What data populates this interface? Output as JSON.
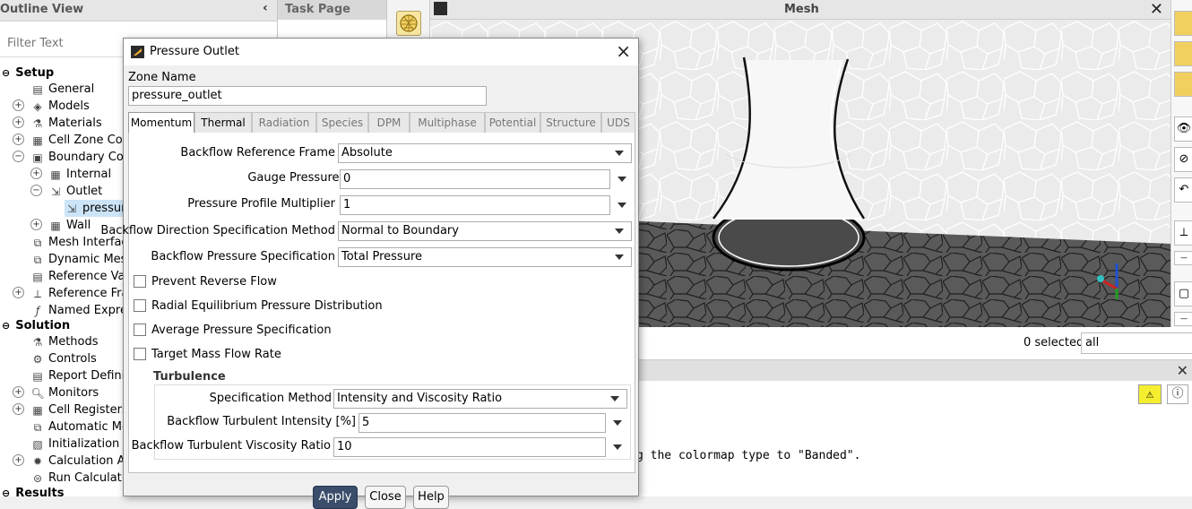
{
  "outline": {
    "title": "Outline View",
    "filter_placeholder": "Filter Text",
    "setup_label": "Setup",
    "general": "General",
    "models": "Models",
    "materials": "Materials",
    "cell_zone": "Cell Zone Con",
    "boundary": "Boundary Con",
    "internal": "Internal",
    "outlet": "Outlet",
    "pressure_outlet": "pressur",
    "wall": "Wall",
    "mesh_interfaces": "Mesh Interface",
    "dynamic_mesh": "Dynamic Mesh",
    "reference_values": "Reference Val",
    "reference_frames": "Reference Fra",
    "named_expressions": "Named Expre",
    "solution_label": "Solution",
    "methods": "Methods",
    "controls": "Controls",
    "report_definitions": "Report Definit",
    "monitors": "Monitors",
    "cell_registers": "Cell Registers",
    "automatic_mesh": "Automatic Me",
    "initialization": "Initialization",
    "calculation_activities": "Calculation Act",
    "run_calculation": "Run Calculatio",
    "results_label": "Results"
  },
  "taskpage": {
    "title": "Task Page"
  },
  "mesh": {
    "title": "Mesh",
    "selected_text": "0 selected",
    "selection_filter": "all"
  },
  "console": {
    "line": "g the colormap type to \"Banded\"."
  },
  "dialog": {
    "title": "Pressure Outlet",
    "zone_name_label": "Zone Name",
    "zone_name_value": "pressure_outlet",
    "tabs": [
      "Momentum",
      "Thermal",
      "Radiation",
      "Species",
      "DPM",
      "Multiphase",
      "Potential",
      "Structure",
      "UDS"
    ],
    "backflow_ref_frame_label": "Backflow Reference Frame",
    "backflow_ref_frame_value": "Absolute",
    "gauge_pressure_label": "Gauge Pressure [Pa]",
    "gauge_pressure_value": "0",
    "profile_multiplier_label": "Pressure Profile Multiplier",
    "profile_multiplier_value": "1",
    "backflow_direction_label": "Backflow Direction Specification Method",
    "backflow_direction_value": "Normal to Boundary",
    "backflow_pressure_label": "Backflow Pressure Specification",
    "backflow_pressure_value": "Total Pressure",
    "prevent_reverse_flow": "Prevent Reverse Flow",
    "radial_equilibrium": "Radial Equilibrium Pressure Distribution",
    "average_pressure": "Average Pressure Specification",
    "target_mass_flow": "Target Mass Flow Rate",
    "turbulence_label": "Turbulence",
    "spec_method_label": "Specification Method",
    "spec_method_value": "Intensity and Viscosity Ratio",
    "turb_intensity_label": "Backflow Turbulent Intensity [%]",
    "turb_intensity_value": "5",
    "turb_visc_label": "Backflow Turbulent Viscosity Ratio",
    "turb_visc_value": "10",
    "apply": "Apply",
    "close": "Close",
    "help": "Help"
  }
}
